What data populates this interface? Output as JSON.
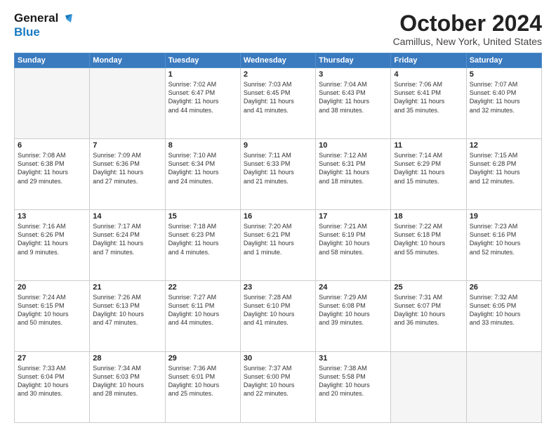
{
  "logo": {
    "line1": "General",
    "line2": "Blue"
  },
  "title": "October 2024",
  "location": "Camillus, New York, United States",
  "days_of_week": [
    "Sunday",
    "Monday",
    "Tuesday",
    "Wednesday",
    "Thursday",
    "Friday",
    "Saturday"
  ],
  "weeks": [
    [
      {
        "day": "",
        "info": ""
      },
      {
        "day": "",
        "info": ""
      },
      {
        "day": "1",
        "info": "Sunrise: 7:02 AM\nSunset: 6:47 PM\nDaylight: 11 hours\nand 44 minutes."
      },
      {
        "day": "2",
        "info": "Sunrise: 7:03 AM\nSunset: 6:45 PM\nDaylight: 11 hours\nand 41 minutes."
      },
      {
        "day": "3",
        "info": "Sunrise: 7:04 AM\nSunset: 6:43 PM\nDaylight: 11 hours\nand 38 minutes."
      },
      {
        "day": "4",
        "info": "Sunrise: 7:06 AM\nSunset: 6:41 PM\nDaylight: 11 hours\nand 35 minutes."
      },
      {
        "day": "5",
        "info": "Sunrise: 7:07 AM\nSunset: 6:40 PM\nDaylight: 11 hours\nand 32 minutes."
      }
    ],
    [
      {
        "day": "6",
        "info": "Sunrise: 7:08 AM\nSunset: 6:38 PM\nDaylight: 11 hours\nand 29 minutes."
      },
      {
        "day": "7",
        "info": "Sunrise: 7:09 AM\nSunset: 6:36 PM\nDaylight: 11 hours\nand 27 minutes."
      },
      {
        "day": "8",
        "info": "Sunrise: 7:10 AM\nSunset: 6:34 PM\nDaylight: 11 hours\nand 24 minutes."
      },
      {
        "day": "9",
        "info": "Sunrise: 7:11 AM\nSunset: 6:33 PM\nDaylight: 11 hours\nand 21 minutes."
      },
      {
        "day": "10",
        "info": "Sunrise: 7:12 AM\nSunset: 6:31 PM\nDaylight: 11 hours\nand 18 minutes."
      },
      {
        "day": "11",
        "info": "Sunrise: 7:14 AM\nSunset: 6:29 PM\nDaylight: 11 hours\nand 15 minutes."
      },
      {
        "day": "12",
        "info": "Sunrise: 7:15 AM\nSunset: 6:28 PM\nDaylight: 11 hours\nand 12 minutes."
      }
    ],
    [
      {
        "day": "13",
        "info": "Sunrise: 7:16 AM\nSunset: 6:26 PM\nDaylight: 11 hours\nand 9 minutes."
      },
      {
        "day": "14",
        "info": "Sunrise: 7:17 AM\nSunset: 6:24 PM\nDaylight: 11 hours\nand 7 minutes."
      },
      {
        "day": "15",
        "info": "Sunrise: 7:18 AM\nSunset: 6:23 PM\nDaylight: 11 hours\nand 4 minutes."
      },
      {
        "day": "16",
        "info": "Sunrise: 7:20 AM\nSunset: 6:21 PM\nDaylight: 11 hours\nand 1 minute."
      },
      {
        "day": "17",
        "info": "Sunrise: 7:21 AM\nSunset: 6:19 PM\nDaylight: 10 hours\nand 58 minutes."
      },
      {
        "day": "18",
        "info": "Sunrise: 7:22 AM\nSunset: 6:18 PM\nDaylight: 10 hours\nand 55 minutes."
      },
      {
        "day": "19",
        "info": "Sunrise: 7:23 AM\nSunset: 6:16 PM\nDaylight: 10 hours\nand 52 minutes."
      }
    ],
    [
      {
        "day": "20",
        "info": "Sunrise: 7:24 AM\nSunset: 6:15 PM\nDaylight: 10 hours\nand 50 minutes."
      },
      {
        "day": "21",
        "info": "Sunrise: 7:26 AM\nSunset: 6:13 PM\nDaylight: 10 hours\nand 47 minutes."
      },
      {
        "day": "22",
        "info": "Sunrise: 7:27 AM\nSunset: 6:11 PM\nDaylight: 10 hours\nand 44 minutes."
      },
      {
        "day": "23",
        "info": "Sunrise: 7:28 AM\nSunset: 6:10 PM\nDaylight: 10 hours\nand 41 minutes."
      },
      {
        "day": "24",
        "info": "Sunrise: 7:29 AM\nSunset: 6:08 PM\nDaylight: 10 hours\nand 39 minutes."
      },
      {
        "day": "25",
        "info": "Sunrise: 7:31 AM\nSunset: 6:07 PM\nDaylight: 10 hours\nand 36 minutes."
      },
      {
        "day": "26",
        "info": "Sunrise: 7:32 AM\nSunset: 6:05 PM\nDaylight: 10 hours\nand 33 minutes."
      }
    ],
    [
      {
        "day": "27",
        "info": "Sunrise: 7:33 AM\nSunset: 6:04 PM\nDaylight: 10 hours\nand 30 minutes."
      },
      {
        "day": "28",
        "info": "Sunrise: 7:34 AM\nSunset: 6:03 PM\nDaylight: 10 hours\nand 28 minutes."
      },
      {
        "day": "29",
        "info": "Sunrise: 7:36 AM\nSunset: 6:01 PM\nDaylight: 10 hours\nand 25 minutes."
      },
      {
        "day": "30",
        "info": "Sunrise: 7:37 AM\nSunset: 6:00 PM\nDaylight: 10 hours\nand 22 minutes."
      },
      {
        "day": "31",
        "info": "Sunrise: 7:38 AM\nSunset: 5:58 PM\nDaylight: 10 hours\nand 20 minutes."
      },
      {
        "day": "",
        "info": ""
      },
      {
        "day": "",
        "info": ""
      }
    ]
  ]
}
